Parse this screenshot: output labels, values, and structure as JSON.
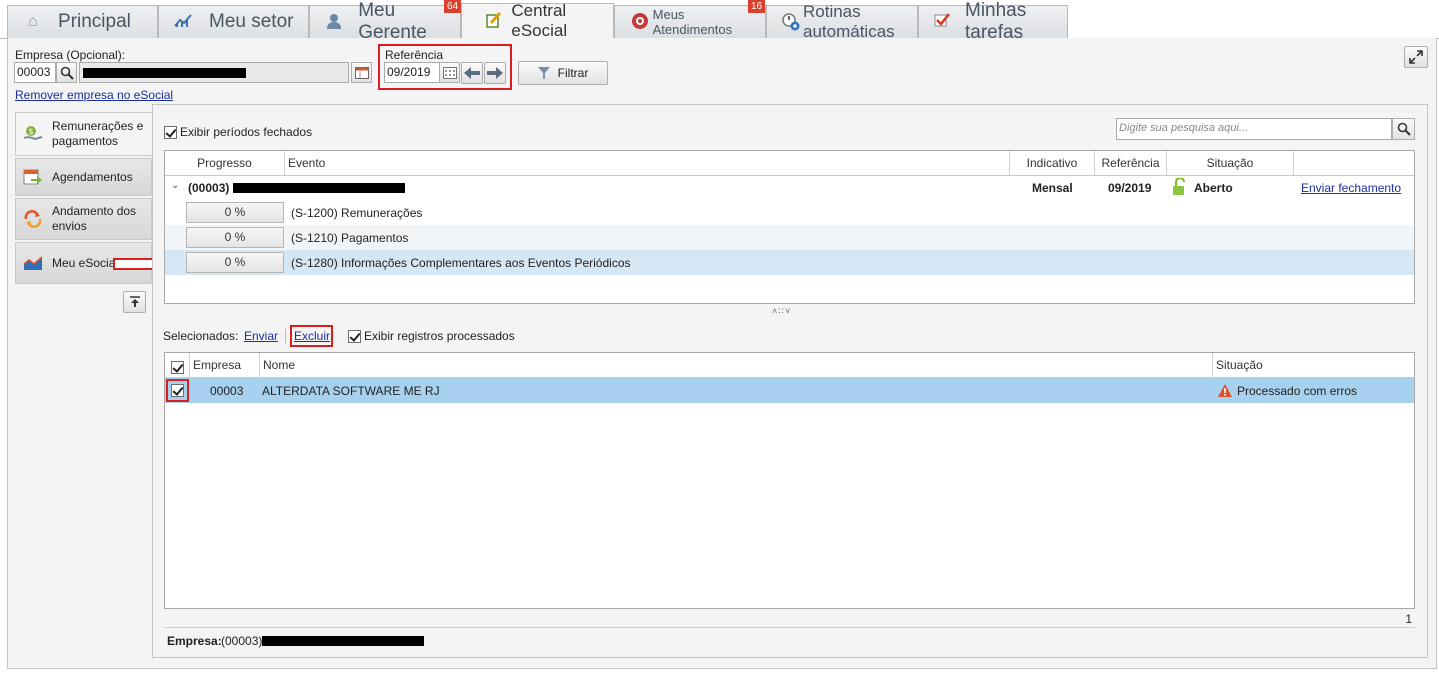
{
  "tabs": [
    {
      "label": "Principal",
      "icon": "home-icon"
    },
    {
      "label": "Meu setor",
      "icon": "chart-icon"
    },
    {
      "label": "Meu Gerente",
      "icon": "user-icon",
      "badge": "64"
    },
    {
      "label": "Central eSocial",
      "icon": "esocial-icon"
    },
    {
      "label": "Meus Atendimentos",
      "icon": "support-icon",
      "badge": "16"
    },
    {
      "label": "Rotinas automáticas",
      "icon": "clock-gear-icon"
    },
    {
      "label": "Minhas tarefas",
      "icon": "checkbox-task-icon"
    }
  ],
  "filters": {
    "empresa_label": "Empresa (Opcional):",
    "empresa_code": "00003",
    "remover_link": "Remover empresa no eSocial",
    "referencia_label": "Referência",
    "referencia_value": "09/2019",
    "filtrar_label": "Filtrar"
  },
  "sidebar": {
    "items": [
      {
        "label": "Remunerações e pagamentos",
        "icon": "money-icon"
      },
      {
        "label": "Agendamentos",
        "icon": "calendar-arrow-icon"
      },
      {
        "label": "Andamento dos envios",
        "icon": "refresh-icon"
      },
      {
        "label": "Meu eSocial",
        "icon": "area-chart-icon"
      }
    ]
  },
  "top_grid": {
    "exibir_fechados_label": "Exibir períodos fechados",
    "search_placeholder": "Digite sua pesquisa aqui...",
    "columns": [
      "Progresso",
      "Evento",
      "Indicativo",
      "Referência",
      "Situação"
    ],
    "group": {
      "code": "(00003)",
      "indicativo": "Mensal",
      "referencia": "09/2019",
      "situacao": "Aberto",
      "action": "Enviar fechamento"
    },
    "rows": [
      {
        "progress": "0 %",
        "evento": "(S-1200) Remunerações"
      },
      {
        "progress": "0 %",
        "evento": "(S-1210) Pagamentos"
      },
      {
        "progress": "0 %",
        "evento": "(S-1280) Informações Complementares aos Eventos Periódicos"
      }
    ]
  },
  "bottom": {
    "selecionados_label": "Selecionados:",
    "enviar_label": "Enviar",
    "excluir_label": "Excluir",
    "exibir_processados_label": "Exibir registros processados",
    "columns": [
      "Empresa",
      "Nome",
      "Situação"
    ],
    "rows": [
      {
        "empresa": "00003",
        "nome": "ALTERDATA SOFTWARE ME RJ",
        "situacao": "Processado com erros"
      }
    ],
    "count": "1",
    "footer_label": "Empresa:",
    "footer_code": "(00003)"
  },
  "colors": {
    "accent_red": "#d81e1e",
    "selected_row": "#a8d1ef",
    "badge": "#d9412d"
  }
}
